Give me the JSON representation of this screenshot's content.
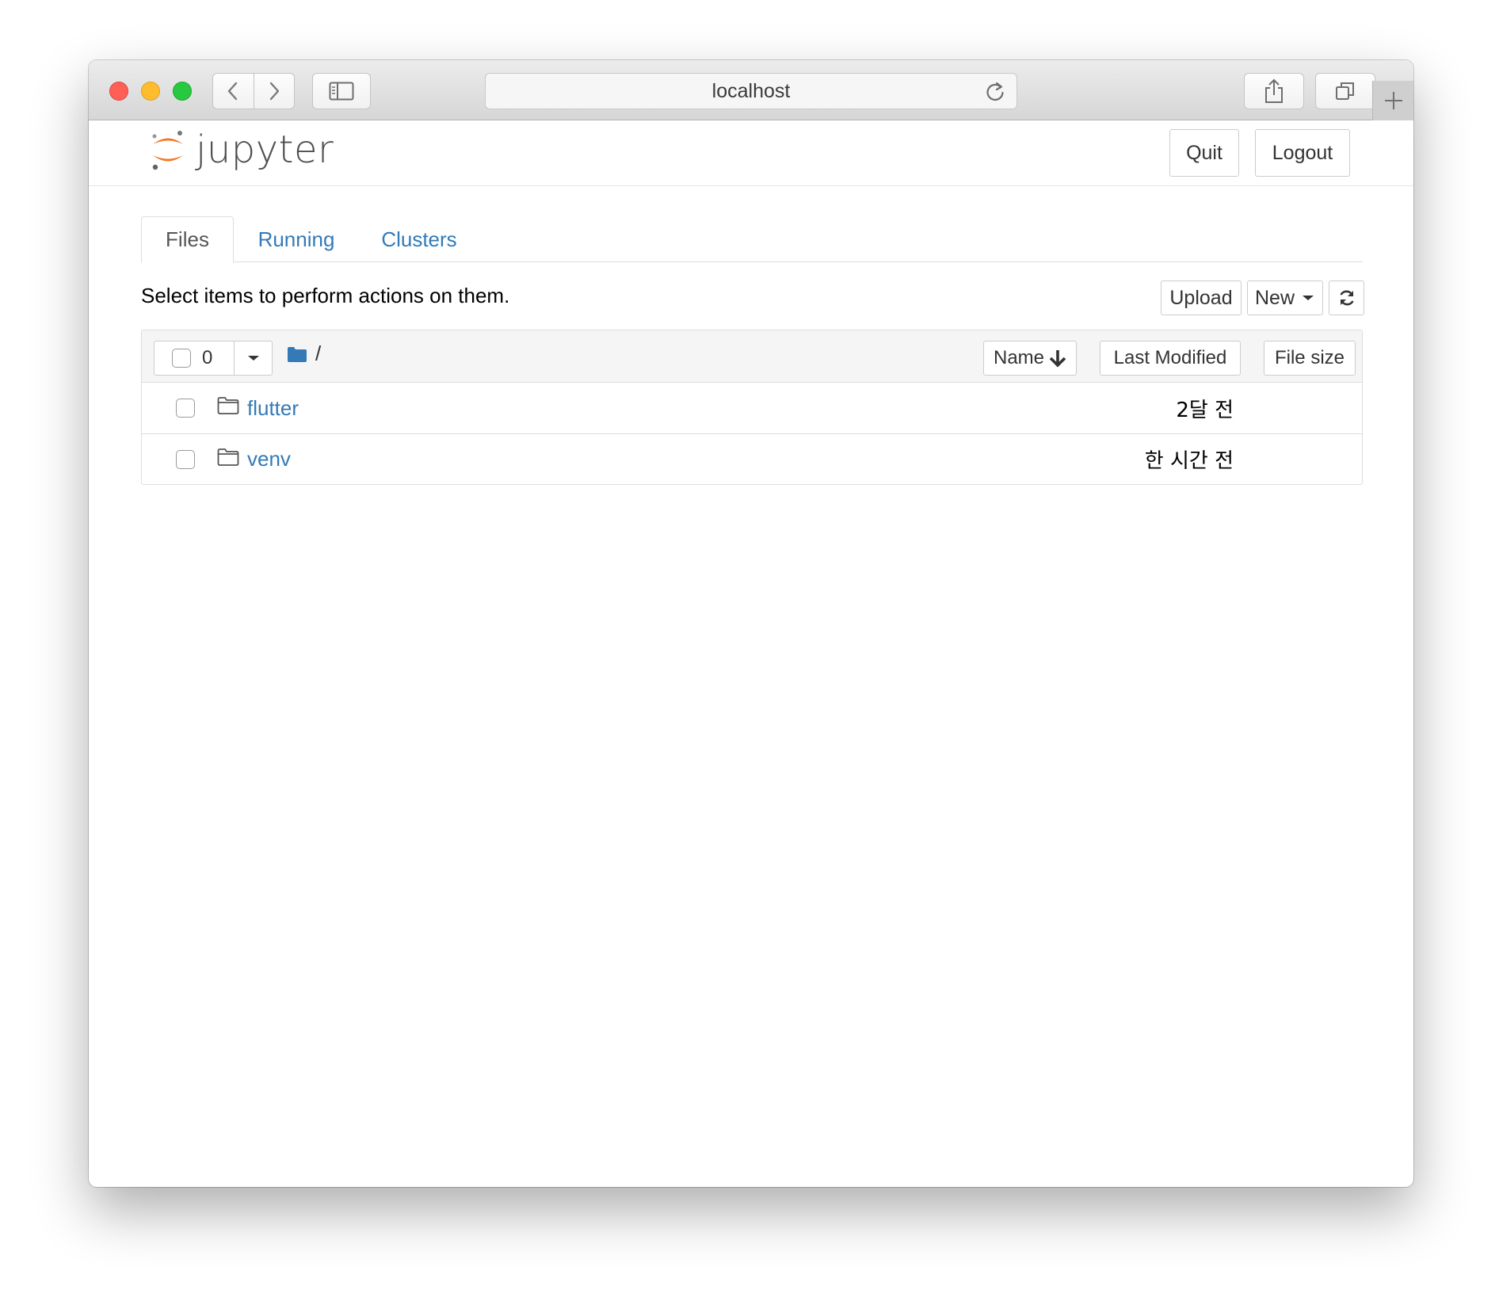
{
  "browser": {
    "url": "localhost"
  },
  "header": {
    "logo_text": "jupyter",
    "quit_label": "Quit",
    "logout_label": "Logout"
  },
  "tabs": [
    {
      "label": "Files",
      "active": true
    },
    {
      "label": "Running",
      "active": false
    },
    {
      "label": "Clusters",
      "active": false
    }
  ],
  "toolbar": {
    "hint": "Select items to perform actions on them.",
    "upload_label": "Upload",
    "new_label": "New"
  },
  "list_header": {
    "selected_count": "0",
    "path": "/",
    "sort_name_label": "Name",
    "sort_modified_label": "Last Modified",
    "sort_size_label": "File size"
  },
  "files": [
    {
      "name": "flutter",
      "type": "folder",
      "modified": "2달 전",
      "checked": false
    },
    {
      "name": "venv",
      "type": "folder",
      "modified": "한 시간 전",
      "checked": false
    }
  ],
  "colors": {
    "link": "#337ab7",
    "jupyter_orange": "#f37726"
  }
}
